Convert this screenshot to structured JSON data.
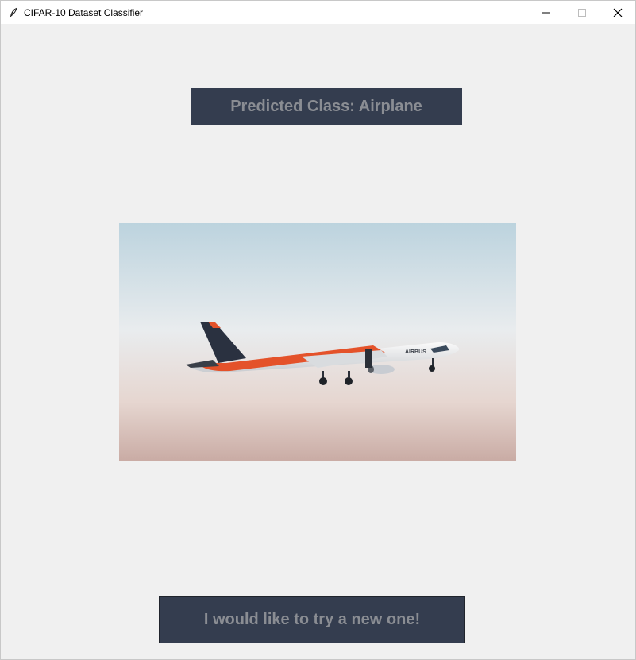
{
  "window": {
    "title": "CIFAR-10 Dataset Classifier"
  },
  "prediction": {
    "label": "Predicted Class: Airplane"
  },
  "image": {
    "subject": "airplane",
    "livery_text": "AIRBUS"
  },
  "actions": {
    "try_new_label": "I would like to try a new one!"
  },
  "colors": {
    "panel_bg": "#343d4f",
    "panel_text": "#8a8d93",
    "window_bg": "#f0f0f0"
  }
}
